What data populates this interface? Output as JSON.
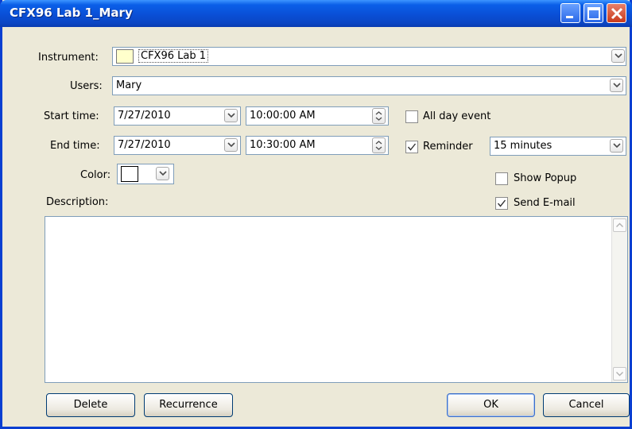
{
  "window": {
    "title": "CFX96 Lab 1_Mary"
  },
  "form": {
    "instrument_label": "Instrument:",
    "instrument_value": "CFX96 Lab 1",
    "users_label": "Users:",
    "users_value": "Mary",
    "start_label": "Start time:",
    "start_date": "7/27/2010",
    "start_time": "10:00:00 AM",
    "end_label": "End time:",
    "end_date": "7/27/2010",
    "end_time": "10:30:00 AM",
    "color_label": "Color:",
    "description_label": "Description:",
    "description_value": "",
    "all_day_label": "All day event",
    "all_day_checked": false,
    "reminder_label": "Reminder",
    "reminder_checked": true,
    "reminder_value": "15 minutes",
    "show_popup_label": "Show Popup",
    "show_popup_checked": false,
    "send_email_label": "Send E-mail",
    "send_email_checked": true
  },
  "buttons": {
    "delete": "Delete",
    "recurrence": "Recurrence",
    "ok": "OK",
    "cancel": "Cancel"
  },
  "colors": {
    "titlebar": "#0a4fd6",
    "dialog_bg": "#ece9d8",
    "instrument_swatch": "#ffffcc",
    "event_color": "#ffffff"
  }
}
